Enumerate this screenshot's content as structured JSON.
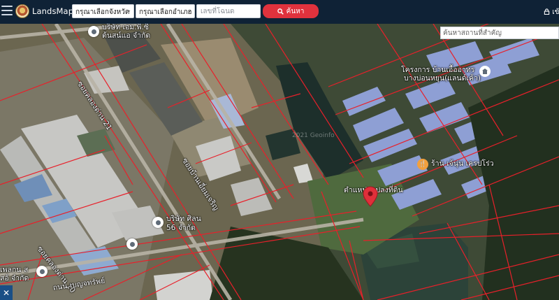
{
  "header": {
    "brand": "LandsMaps",
    "province_placeholder": "กรุณาเลือกจังหวัด",
    "district_placeholder": "กรุณาเลือกอำเภอ",
    "deed_placeholder": "เลขที่โฉนด",
    "search_label": "ค้นหา",
    "login_label": "เข้"
  },
  "map": {
    "place_search_placeholder": "ค้นหาสถานที่สำคัญ",
    "labels": {
      "company_top_1": "บริษัท เอม.พี.ซี",
      "company_top_2": "ต้นสน์แอ จำกัด",
      "soi_khlong_21": "ซอยคลองด่าน 21",
      "soi_mid": "ซอยบ้านเอี่ยมเจริญ",
      "project_1": "โครงการ บ้านเอื้ออาทร",
      "project_2": "บางบ่อนหยุน(แลนด์เค้า)",
      "shop": "ร้าน เจ้นุ่น เครปโร่ว",
      "land_position": "ตำแหน่งแปลงที่ดิน",
      "company_56_1": "บริษัท ศิลน",
      "company_56_2": "56 จำกัด",
      "soi_bottom_left": "ซอยคลองด่าน 10",
      "road_bottom": "ถนน เบญจทรัพย์",
      "company_bottom_1": "เพลกน ส",
      "company_bottom_2": "สอ้ จำกัด",
      "watermark": "2021 Geoinfo"
    },
    "colors": {
      "parcel_line": "#e8202a",
      "pin": "#e02f3a",
      "accent": "#e0323d"
    }
  }
}
